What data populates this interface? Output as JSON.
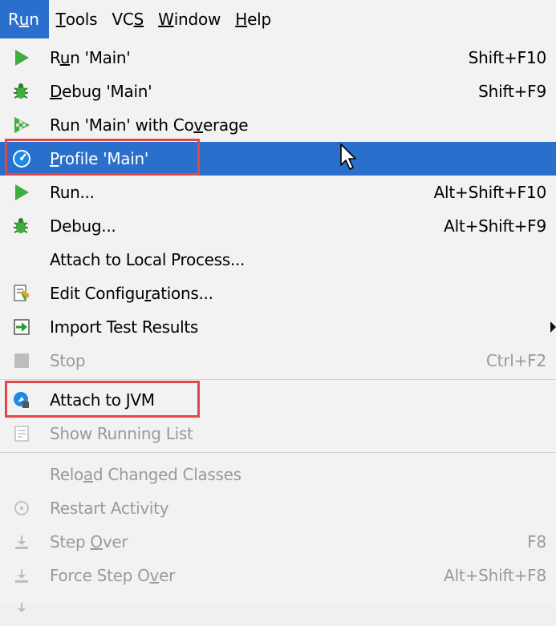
{
  "menubar": {
    "items": [
      {
        "pre": "R",
        "u": "u",
        "post": "n"
      },
      {
        "pre": "",
        "u": "T",
        "post": "ools"
      },
      {
        "pre": "VC",
        "u": "S",
        "post": ""
      },
      {
        "pre": "",
        "u": "W",
        "post": "indow"
      },
      {
        "pre": "",
        "u": "H",
        "post": "elp"
      }
    ]
  },
  "menu": {
    "run_main": {
      "pre": "R",
      "u": "u",
      "post": "n 'Main'",
      "shortcut": "Shift+F10",
      "icon": "run-icon"
    },
    "debug_main": {
      "pre": "",
      "u": "D",
      "post": "ebug 'Main'",
      "shortcut": "Shift+F9",
      "icon": "debug-icon"
    },
    "run_coverage": {
      "pre": "Run 'Main' with Co",
      "u": "v",
      "post": "erage",
      "icon": "coverage-icon"
    },
    "profile_main": {
      "pre": "",
      "u": "P",
      "post": "rofile 'Main'",
      "icon": "profile-icon"
    },
    "run_ellipsis": {
      "label": "Run...",
      "shortcut": "Alt+Shift+F10",
      "icon": "run-icon"
    },
    "debug_ellipsis": {
      "label": "Debug...",
      "shortcut": "Alt+Shift+F9",
      "icon": "debug-icon"
    },
    "attach_local": {
      "label": "Attach to Local Process..."
    },
    "edit_config": {
      "pre": "Edit Configu",
      "u": "r",
      "post": "ations...",
      "icon": "edit-config-icon"
    },
    "import_tests": {
      "label": "Import Test Results",
      "icon": "import-icon"
    },
    "stop": {
      "label": "Stop",
      "shortcut": "Ctrl+F2",
      "icon": "stop-icon"
    },
    "attach_jvm": {
      "label": "Attach to JVM",
      "icon": "attach-jvm-icon"
    },
    "show_running": {
      "label": "Show Running List",
      "icon": "list-icon"
    },
    "reload_classes": {
      "pre": "Relo",
      "u": "a",
      "post": "d Changed Classes"
    },
    "restart_activity": {
      "label": "Restart Activity",
      "icon": "restart-icon"
    },
    "step_over": {
      "pre": "Step ",
      "u": "O",
      "post": "ver",
      "shortcut": "F8",
      "icon": "step-over-icon"
    },
    "force_step_over": {
      "pre": "Force Step O",
      "u": "v",
      "post": "er",
      "shortcut": "Alt+Shift+F8",
      "icon": "force-step-over-icon"
    }
  },
  "colors": {
    "selection": "#2a6fcb",
    "highlight": "#e04848",
    "run_green": "#3fae3f",
    "disabled": "#9a9a9a"
  }
}
